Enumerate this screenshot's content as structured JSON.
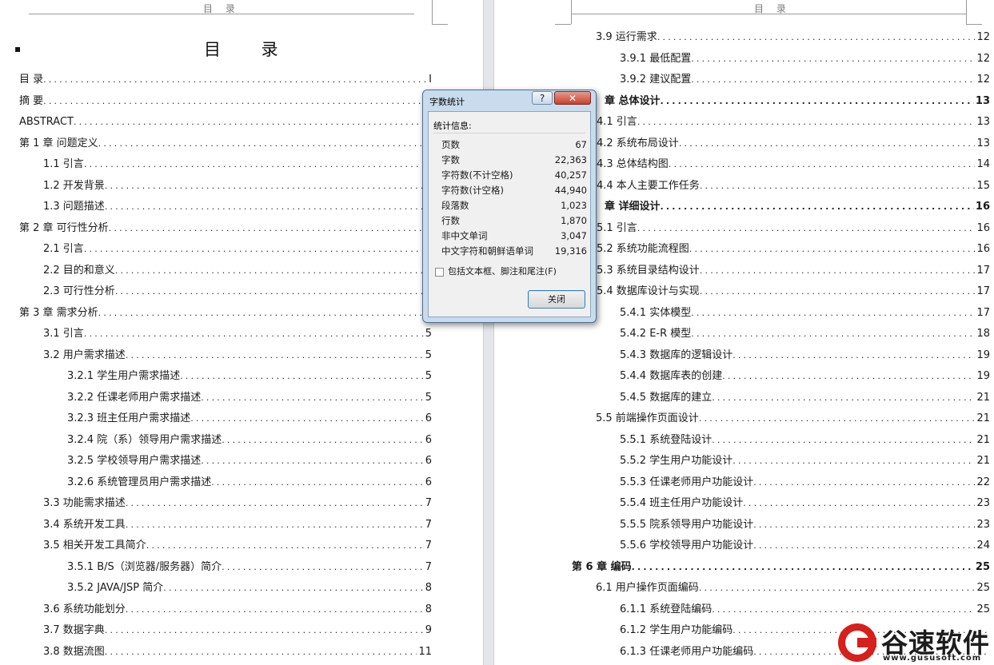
{
  "header": {
    "left_text": "目 录",
    "right_text": "目 录"
  },
  "document": {
    "title": "目  录"
  },
  "toc_left": [
    {
      "label": "目  录",
      "page": "I",
      "bold": false
    },
    {
      "label": "摘  要",
      "page": "",
      "bold": false
    },
    {
      "label": "ABSTRACT",
      "page": "",
      "bold": false
    },
    {
      "label": "第 1 章  问题定义",
      "page": "",
      "bold": false
    },
    {
      "label": "1.1 引言",
      "page": "",
      "bold": false
    },
    {
      "label": "1.2 开发背景",
      "page": "",
      "bold": false
    },
    {
      "label": "1.3 问题描述",
      "page": "",
      "bold": false
    },
    {
      "label": "第 2 章   可行性分析",
      "page": "",
      "bold": false
    },
    {
      "label": "2.1 引言",
      "page": "",
      "bold": false
    },
    {
      "label": "2.2 目的和意义",
      "page": "",
      "bold": false
    },
    {
      "label": "2.3 可行性分析",
      "page": "",
      "bold": false
    },
    {
      "label": "第 3 章   需求分析",
      "page": "",
      "bold": false
    },
    {
      "label": "3.1 引言",
      "page": "5",
      "bold": false
    },
    {
      "label": "3.2 用户需求描述",
      "page": "5",
      "bold": false
    },
    {
      "label": "3.2.1 学生用户需求描述",
      "page": "5",
      "bold": false
    },
    {
      "label": "3.2.2 任课老师用户需求描述",
      "page": "5",
      "bold": false
    },
    {
      "label": "3.2.3 班主任用户需求描述",
      "page": "6",
      "bold": false
    },
    {
      "label": "3.2.4 院（系）领导用户需求描述",
      "page": "6",
      "bold": false
    },
    {
      "label": "3.2.5 学校领导用户需求描述",
      "page": "6",
      "bold": false
    },
    {
      "label": "3.2.6 系统管理员用户需求描述",
      "page": "6",
      "bold": false
    },
    {
      "label": "3.3 功能需求描述",
      "page": "7",
      "bold": false
    },
    {
      "label": "3.4 系统开发工具",
      "page": "7",
      "bold": false
    },
    {
      "label": "3.5 相关开发工具简介",
      "page": "7",
      "bold": false
    },
    {
      "label": "3.5.1 B/S（浏览器/服务器）简介",
      "page": "7",
      "bold": false
    },
    {
      "label": "3.5.2 JAVA/JSP 简介",
      "page": "8",
      "bold": false
    },
    {
      "label": "3.6 系统功能划分",
      "page": "8",
      "bold": false
    },
    {
      "label": "3.7 数据字典",
      "page": "9",
      "bold": false
    },
    {
      "label": "3.8 数据流图",
      "page": "11",
      "bold": false
    }
  ],
  "toc_right": [
    {
      "label": "3.9 运行需求",
      "page": "12",
      "bold": false
    },
    {
      "label": "3.9.1 最低配置",
      "page": "12",
      "bold": false
    },
    {
      "label": "3.9.2 建议配置",
      "page": "12",
      "bold": false
    },
    {
      "label": "章   总体设计",
      "page": "13",
      "bold": true
    },
    {
      "label": "4.1 引言",
      "page": "13",
      "bold": false
    },
    {
      "label": "4.2 系统布局设计",
      "page": "13",
      "bold": false
    },
    {
      "label": "4.3 总体结构图",
      "page": "14",
      "bold": false
    },
    {
      "label": "4.4 本人主要工作任务",
      "page": "15",
      "bold": false
    },
    {
      "label": "章   详细设计",
      "page": "16",
      "bold": true
    },
    {
      "label": "5.1 引言",
      "page": "16",
      "bold": false
    },
    {
      "label": "5.2 系统功能流程图",
      "page": "16",
      "bold": false
    },
    {
      "label": "5.3 系统目录结构设计",
      "page": "17",
      "bold": false
    },
    {
      "label": "5.4 数据库设计与实现",
      "page": "17",
      "bold": false
    },
    {
      "label": "5.4.1 实体模型",
      "page": "17",
      "bold": false
    },
    {
      "label": "5.4.2 E-R 模型",
      "page": "18",
      "bold": false
    },
    {
      "label": "5.4.3 数据库的逻辑设计",
      "page": "19",
      "bold": false
    },
    {
      "label": "5.4.4 数据库表的创建",
      "page": "19",
      "bold": false
    },
    {
      "label": "5.4.5 数据库的建立",
      "page": "21",
      "bold": false
    },
    {
      "label": "5.5 前端操作页面设计",
      "page": "21",
      "bold": false
    },
    {
      "label": "5.5.1 系统登陆设计",
      "page": "21",
      "bold": false
    },
    {
      "label": "5.5.2 学生用户功能设计",
      "page": "21",
      "bold": false
    },
    {
      "label": "5.5.3 任课老师用户功能设计",
      "page": "22",
      "bold": false
    },
    {
      "label": "5.5.4 班主任用户功能设计",
      "page": "23",
      "bold": false
    },
    {
      "label": "5.5.5 院系领导用户功能设计",
      "page": "23",
      "bold": false
    },
    {
      "label": "5.5.6 学校领导用户功能设计",
      "page": "24",
      "bold": false
    },
    {
      "label": "第 6 章   编码",
      "page": "25",
      "bold": true
    },
    {
      "label": "6.1 用户操作页面编码",
      "page": "25",
      "bold": false
    },
    {
      "label": "6.1.1 系统登陆编码",
      "page": "25",
      "bold": false
    },
    {
      "label": "6.1.2 学生用户功能编码",
      "page": "",
      "bold": false
    },
    {
      "label": "6.1.3 任课老师用户功能编码",
      "page": "",
      "bold": false
    }
  ],
  "dialog": {
    "title": "字数统计",
    "help_label": "?",
    "close_label": "✕",
    "group_label": "统计信息:",
    "stats": [
      {
        "label": "页数",
        "value": "67"
      },
      {
        "label": "字数",
        "value": "22,363"
      },
      {
        "label": "字符数(不计空格)",
        "value": "40,257"
      },
      {
        "label": "字符数(计空格)",
        "value": "44,940"
      },
      {
        "label": "段落数",
        "value": "1,023"
      },
      {
        "label": "行数",
        "value": "1,870"
      },
      {
        "label": "非中文单词",
        "value": "3,047"
      },
      {
        "label": "中文字符和朝鲜语单词",
        "value": "19,316"
      }
    ],
    "checkbox_label": "包括文本框、脚注和尾注(F)",
    "checkbox_checked": false,
    "ok_label": "关闭"
  },
  "watermark": {
    "name": "谷速软件",
    "url": "www.gususoft.com"
  }
}
